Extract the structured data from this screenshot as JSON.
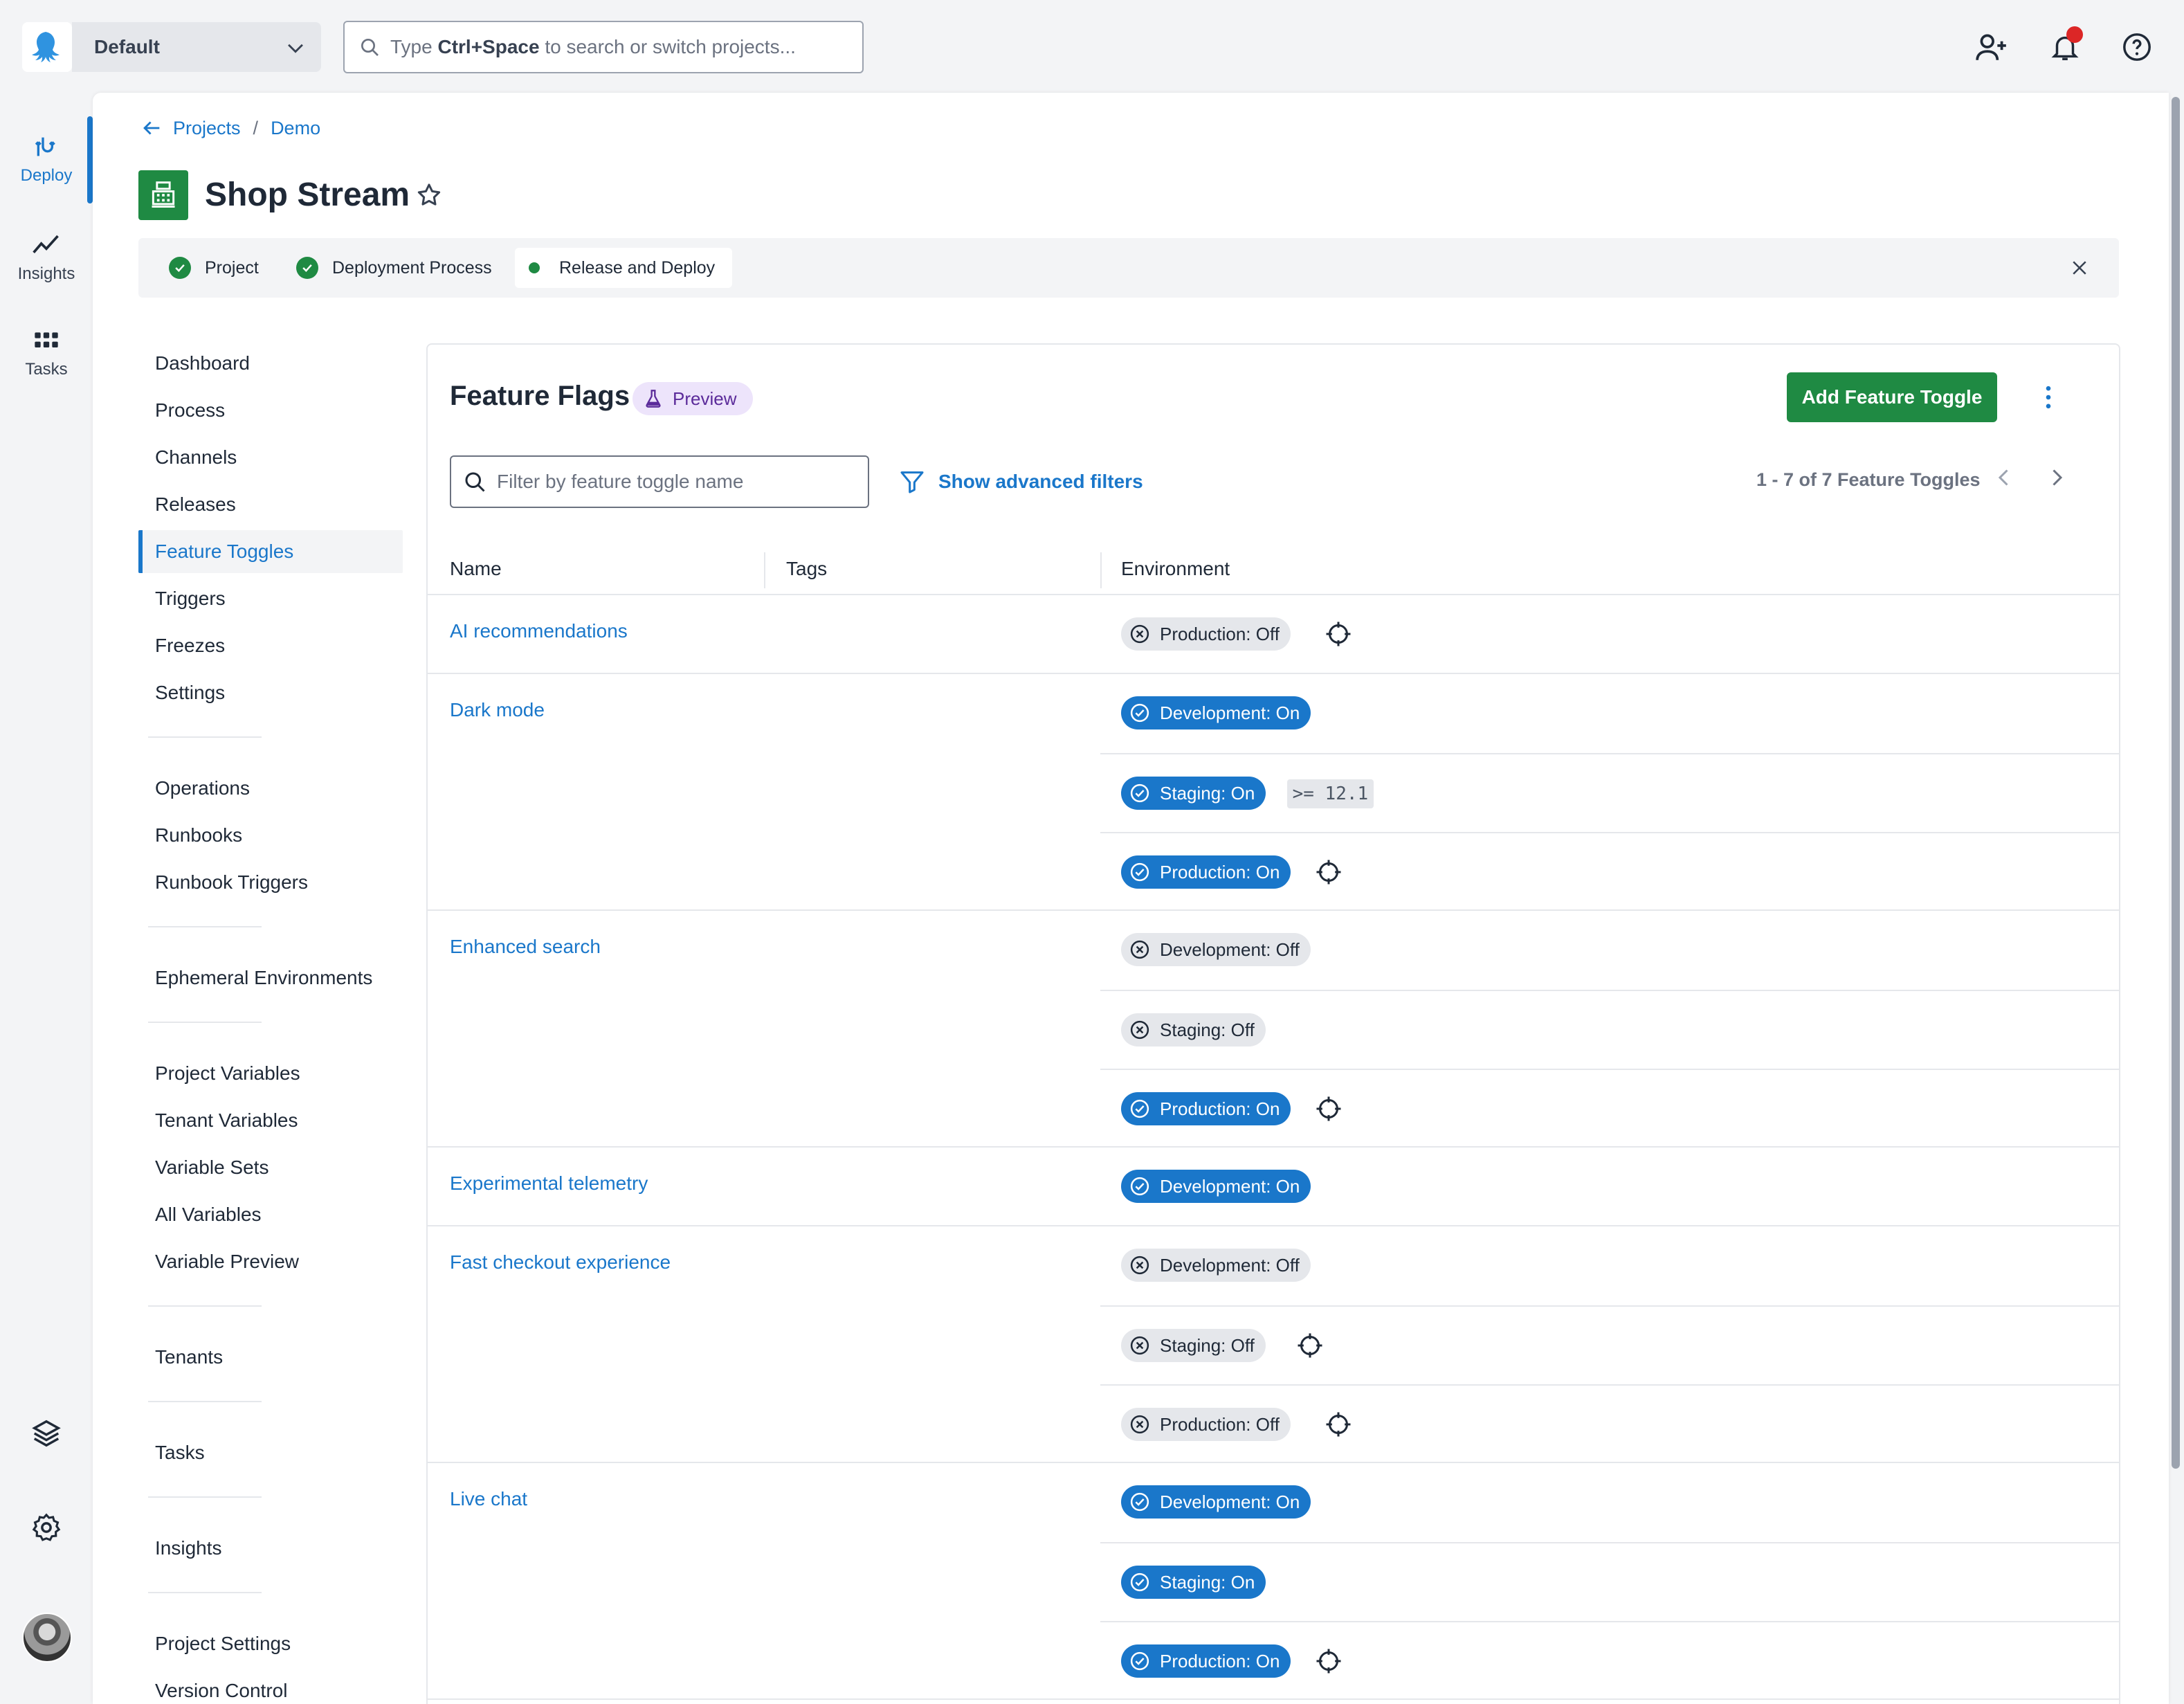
{
  "topbar": {
    "space": "Default",
    "search": {
      "prefix": "Type",
      "shortcut": "Ctrl+Space",
      "suffix": "to search or switch projects..."
    },
    "icons": [
      "invite-user-icon",
      "bell-icon",
      "help-icon"
    ]
  },
  "rail": {
    "items": [
      {
        "label": "Deploy",
        "icon": "deploy-icon",
        "active": true
      },
      {
        "label": "Insights",
        "icon": "insights-icon"
      },
      {
        "label": "Tasks",
        "icon": "tasks-icon"
      }
    ],
    "bottom_icons": [
      "layers-icon",
      "gear-icon",
      "avatar"
    ]
  },
  "breadcrumb": {
    "projects": "Projects",
    "sep": "/",
    "group": "Demo"
  },
  "project": {
    "title": "Shop Stream"
  },
  "steps": {
    "items": [
      {
        "label": "Project",
        "state": "done"
      },
      {
        "label": "Deployment Process",
        "state": "done"
      },
      {
        "label": "Release and Deploy",
        "state": "current"
      }
    ]
  },
  "nav": {
    "items": [
      "Dashboard",
      "Process",
      "Channels",
      "Releases",
      "Feature Toggles",
      "Triggers",
      "Freezes",
      "Settings",
      "Operations",
      "Runbooks",
      "Runbook Triggers",
      "Ephemeral Environments",
      "Project Variables",
      "Tenant Variables",
      "Variable Sets",
      "All Variables",
      "Variable Preview",
      "Tenants",
      "Tasks",
      "Insights",
      "Project Settings",
      "Version Control"
    ],
    "active": "Feature Toggles"
  },
  "feature_flags": {
    "title": "Feature Flags",
    "badge": "Preview",
    "add_button": "Add Feature Toggle",
    "filter_placeholder": "Filter by feature toggle name",
    "advanced_filters": "Show advanced filters",
    "pager": "1 - 7 of 7 Feature Toggles",
    "columns": {
      "name": "Name",
      "tags": "Tags",
      "environment": "Environment"
    },
    "toggles": [
      {
        "name": "AI recommendations",
        "envs": [
          {
            "label": "Production: Off",
            "on": false,
            "target": true
          }
        ]
      },
      {
        "name": "Dark mode",
        "envs": [
          {
            "label": "Development: On",
            "on": true
          },
          {
            "label": "Staging: On",
            "on": true,
            "rule": ">= 12.1"
          },
          {
            "label": "Production: On",
            "on": true,
            "target": true
          }
        ]
      },
      {
        "name": "Enhanced search",
        "envs": [
          {
            "label": "Development: Off",
            "on": false
          },
          {
            "label": "Staging: Off",
            "on": false
          },
          {
            "label": "Production: On",
            "on": true,
            "target": true
          }
        ]
      },
      {
        "name": "Experimental telemetry",
        "envs": [
          {
            "label": "Development: On",
            "on": true
          }
        ]
      },
      {
        "name": "Fast checkout experience",
        "envs": [
          {
            "label": "Development: Off",
            "on": false
          },
          {
            "label": "Staging: Off",
            "on": false,
            "target": true
          },
          {
            "label": "Production: Off",
            "on": false,
            "target": true
          }
        ]
      },
      {
        "name": "Live chat",
        "envs": [
          {
            "label": "Development: On",
            "on": true
          },
          {
            "label": "Staging: On",
            "on": true
          },
          {
            "label": "Production: On",
            "on": true,
            "target": true
          }
        ]
      }
    ]
  },
  "colors": {
    "accent": "#1a77ca",
    "success": "#1f8a43",
    "preview": "#5b2b9a",
    "notification": "#dc2626"
  }
}
